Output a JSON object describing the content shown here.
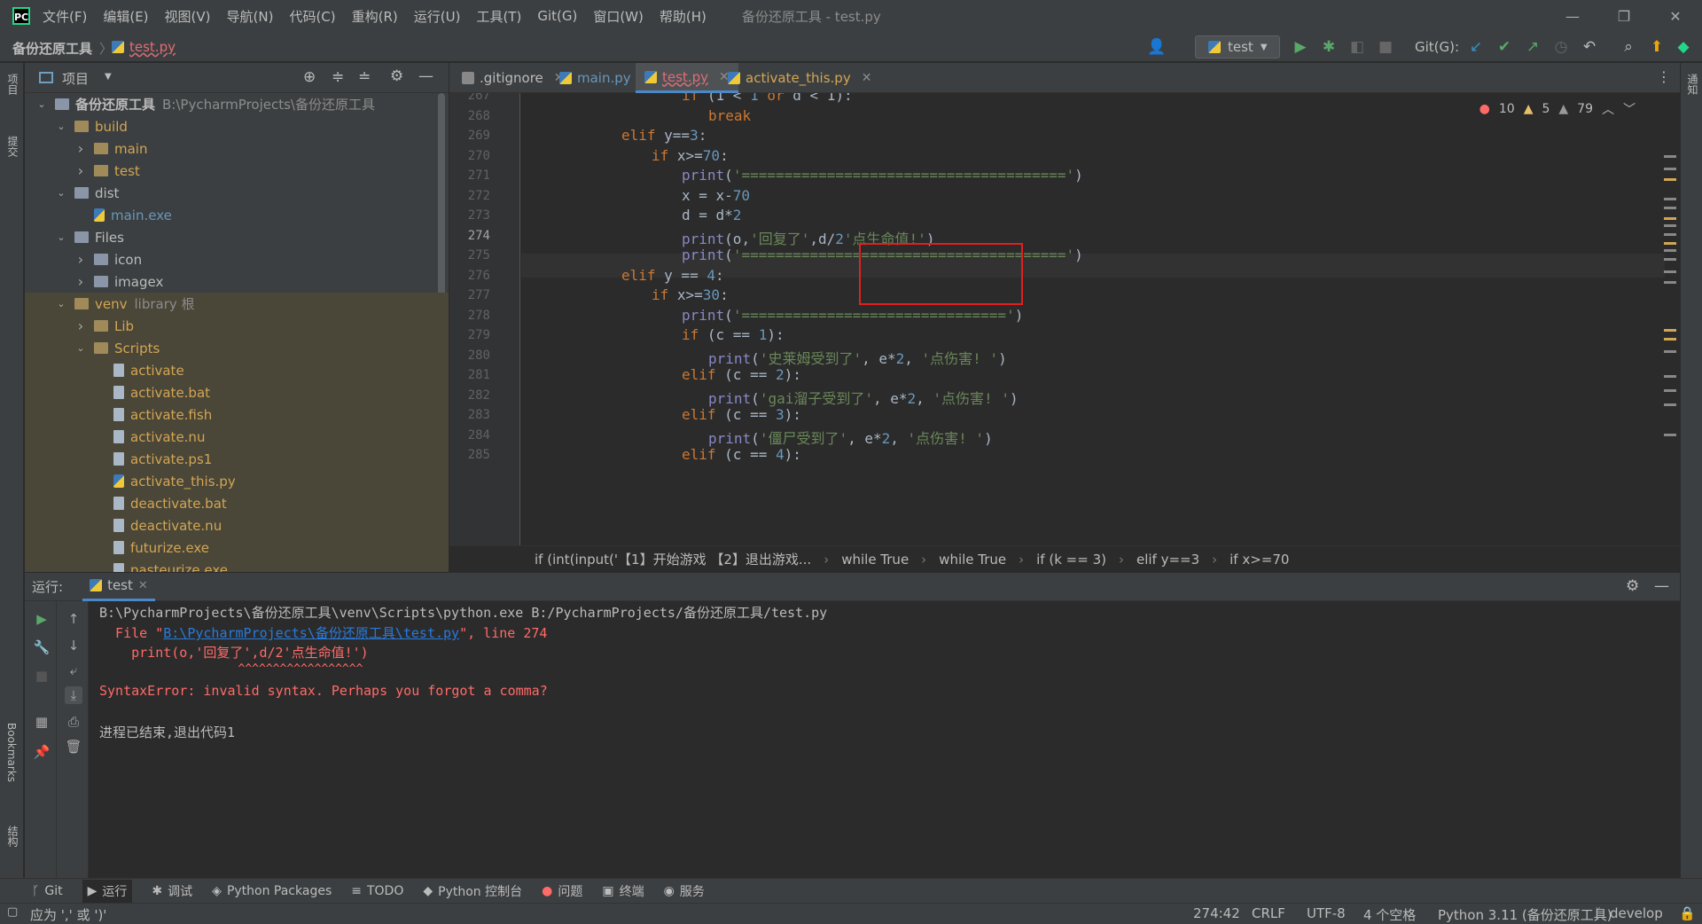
{
  "menubar": {
    "items": [
      "文件(F)",
      "编辑(E)",
      "视图(V)",
      "导航(N)",
      "代码(C)",
      "重构(R)",
      "运行(U)",
      "工具(T)",
      "Git(G)",
      "窗口(W)",
      "帮助(H)"
    ],
    "title": "备份还原工具 - test.py"
  },
  "navbar": {
    "project": "备份还原工具",
    "file": "test.py",
    "run_config": "test",
    "git_label": "Git(G):"
  },
  "left_strip": {
    "project": "项目",
    "commit": "提交",
    "bookmarks": "Bookmarks",
    "structure": "结构"
  },
  "right_strip": {
    "notifications": "通知"
  },
  "project_panel": {
    "title": "项目"
  },
  "tree": [
    {
      "label": "备份还原工具",
      "extra": "B:\\PycharmProjects\\备份还原工具",
      "depth": 0,
      "open": true,
      "type": "folder",
      "bold": true
    },
    {
      "label": "build",
      "depth": 1,
      "open": true,
      "type": "folder",
      "color": "#d3a653"
    },
    {
      "label": "main",
      "depth": 2,
      "open": false,
      "type": "folder",
      "color": "#d3a653"
    },
    {
      "label": "test",
      "depth": 2,
      "open": false,
      "type": "folder",
      "color": "#d3a653"
    },
    {
      "label": "dist",
      "depth": 1,
      "open": true,
      "type": "folder"
    },
    {
      "label": "main.exe",
      "depth": 2,
      "type": "py",
      "color": "#6897bb"
    },
    {
      "label": "Files",
      "depth": 1,
      "open": true,
      "type": "folder"
    },
    {
      "label": "icon",
      "depth": 2,
      "open": false,
      "type": "folder"
    },
    {
      "label": "imagex",
      "depth": 2,
      "open": false,
      "type": "folder"
    },
    {
      "label": "venv",
      "extra": "library 根",
      "depth": 1,
      "open": true,
      "type": "folder",
      "color": "#d3a653",
      "venv": true
    },
    {
      "label": "Lib",
      "depth": 2,
      "open": false,
      "type": "folder",
      "color": "#d3a653",
      "venv": true
    },
    {
      "label": "Scripts",
      "depth": 2,
      "open": true,
      "type": "folder",
      "color": "#d3a653",
      "venv": true
    },
    {
      "label": "activate",
      "depth": 3,
      "type": "file",
      "color": "#d3a653",
      "venv": true
    },
    {
      "label": "activate.bat",
      "depth": 3,
      "type": "file",
      "color": "#d3a653",
      "venv": true
    },
    {
      "label": "activate.fish",
      "depth": 3,
      "type": "file",
      "color": "#d3a653",
      "venv": true
    },
    {
      "label": "activate.nu",
      "depth": 3,
      "type": "file",
      "color": "#d3a653",
      "venv": true
    },
    {
      "label": "activate.ps1",
      "depth": 3,
      "type": "file",
      "color": "#d3a653",
      "venv": true
    },
    {
      "label": "activate_this.py",
      "depth": 3,
      "type": "py",
      "color": "#d3a653",
      "venv": true
    },
    {
      "label": "deactivate.bat",
      "depth": 3,
      "type": "file",
      "color": "#d3a653",
      "venv": true
    },
    {
      "label": "deactivate.nu",
      "depth": 3,
      "type": "file",
      "color": "#d3a653",
      "venv": true
    },
    {
      "label": "futurize.exe",
      "depth": 3,
      "type": "file",
      "color": "#d3a653",
      "venv": true
    },
    {
      "label": "pasteurize.exe",
      "depth": 3,
      "type": "file",
      "color": "#d3a653",
      "venv": true
    }
  ],
  "tabs": [
    {
      "label": ".gitignore",
      "color": "#bbbbbb"
    },
    {
      "label": "main.py",
      "color": "#6897bb"
    },
    {
      "label": "test.py",
      "color": "#e06c75",
      "active": true
    },
    {
      "label": "activate_this.py",
      "color": "#d3a653"
    }
  ],
  "inspections": {
    "errors": "10",
    "warnings": "5",
    "weak": "79"
  },
  "code": {
    "line_numbers": [
      "267",
      "268",
      "269",
      "270",
      "271",
      "272",
      "273",
      "274",
      "275",
      "276",
      "277",
      "278",
      "279",
      "280",
      "281",
      "282",
      "283",
      "284",
      "285"
    ],
    "current_line": "274",
    "l267_kw": "if",
    "l267_rest": " (1 < ",
    "l267_n1": "1",
    "l267_or": " or ",
    "l267_rest2": "d < 1):",
    "l268": "break",
    "l269_kw": "elif",
    "l269_rest": " y==",
    "l269_n": "3",
    "l269_c": ":",
    "l270_kw": "if",
    "l270_rest": " x>=",
    "l270_n": "70",
    "l270_c": ":",
    "l271_fn": "print",
    "l271_str": "'======================================'",
    "l271_p": ")",
    "l272_a": "x = x-",
    "l272_n": "70",
    "l273_a": "d = d*",
    "l273_n": "2",
    "l274_fn": "print",
    "l274_a": "(o,",
    "l274_s1": "'回复了'",
    "l274_b": ",d/",
    "l274_n": "2",
    "l274_s2": "'点生命值!'",
    "l274_c": ")",
    "l275_fn": "print",
    "l275_str": "'======================================'",
    "l275_p": ")",
    "l276_kw": "elif",
    "l276_rest": " y == ",
    "l276_n": "4",
    "l276_c": ":",
    "l277_kw": "if",
    "l277_rest": " x>=",
    "l277_n": "30",
    "l277_c": ":",
    "l278_fn": "print",
    "l278_str": "'==============================='",
    "l278_p": ")",
    "l279_kw": "if",
    "l279_rest": " (c == ",
    "l279_n": "1",
    "l279_c": "):",
    "l280_fn": "print",
    "l280_s1": "'史莱姆受到了'",
    "l280_a": ", e*",
    "l280_n": "2",
    "l280_s2": "'点伤害! '",
    "l280_p": ")",
    "l281_kw": "elif",
    "l281_rest": " (c == ",
    "l281_n": "2",
    "l281_c": "):",
    "l282_fn": "print",
    "l282_s1": "'gai溜子受到了'",
    "l282_a": ", e*",
    "l282_n": "2",
    "l282_s2": "'点伤害! '",
    "l282_p": ")",
    "l283_kw": "elif",
    "l283_rest": " (c == ",
    "l283_n": "3",
    "l283_c": "):",
    "l284_fn": "print",
    "l284_s1": "'僵尸受到了'",
    "l284_a": ", e*",
    "l284_n": "2",
    "l284_s2": "'点伤害! '",
    "l284_p": ")",
    "l285_kw": "elif",
    "l285_rest": " (c == ",
    "l285_n": "4",
    "l285_c": "):"
  },
  "breadcrumbs": [
    "if (int(input('【1】开始游戏 【2】退出游戏...",
    "while True",
    "while True",
    "if (k == 3)",
    "elif y==3",
    "if x>=70"
  ],
  "run_panel": {
    "label": "运行:",
    "tab": "test"
  },
  "console": {
    "cmd": "B:\\PycharmProjects\\备份还原工具\\venv\\Scripts\\python.exe B:/PycharmProjects/备份还原工具/test.py",
    "file_prefix": "  File \"",
    "file_link": "B:\\PycharmProjects\\备份还原工具\\test.py",
    "file_suffix": "\", line 274",
    "code_line": "    print(o,'回复了',d/2'点生命值!')",
    "caret": "                    ^^^^^^^^^^^^^^^^^^",
    "error": "SyntaxError: invalid syntax. Perhaps you forgot a comma?",
    "exit": "进程已结束,退出代码1"
  },
  "bottom_tabs": [
    "Git",
    "运行",
    "调试",
    "Python Packages",
    "TODO",
    "Python 控制台",
    "问题",
    "终端",
    "服务"
  ],
  "status": {
    "hint": "应为 ',' 或 ')'",
    "position": "274:42",
    "line_sep": "CRLF",
    "encoding": "UTF-8",
    "indent": "4 个空格",
    "interpreter": "Python 3.11 (备份还原工具)",
    "branch": "develop"
  },
  "colors": {
    "accent": "#4a88c7",
    "error": "#ff6b68",
    "link": "#287bde"
  }
}
